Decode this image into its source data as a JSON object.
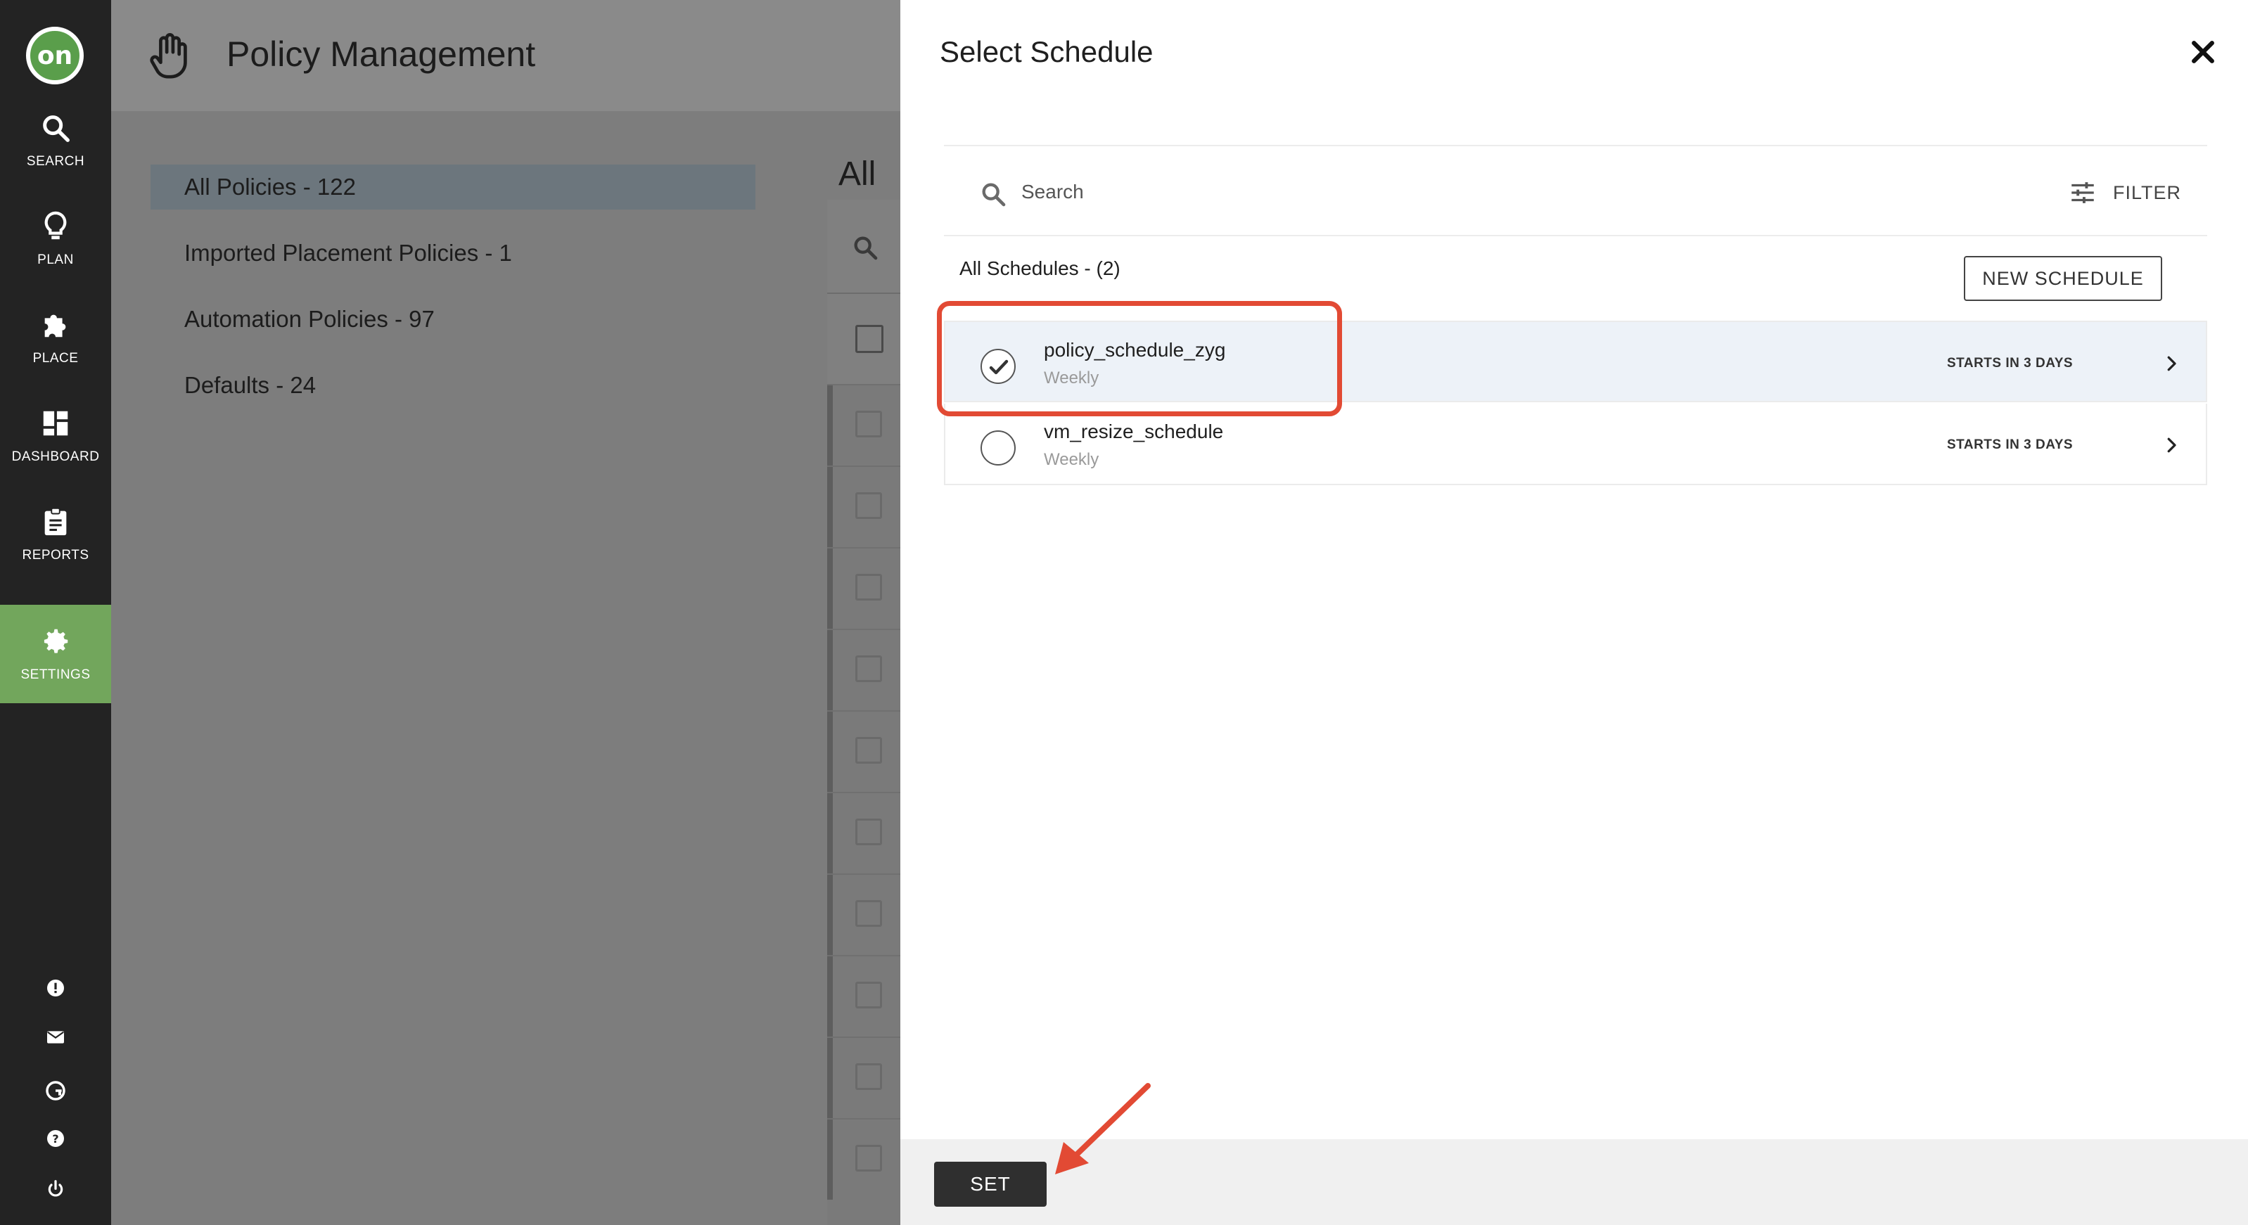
{
  "nav": {
    "logo_text": "on",
    "items": [
      {
        "label": "SEARCH",
        "icon": "search-icon"
      },
      {
        "label": "PLAN",
        "icon": "lightbulb-icon"
      },
      {
        "label": "PLACE",
        "icon": "puzzle-icon"
      },
      {
        "label": "DASHBOARD",
        "icon": "dashboard-icon"
      },
      {
        "label": "REPORTS",
        "icon": "clipboard-icon"
      },
      {
        "label": "SETTINGS",
        "icon": "gear-icon",
        "active": true
      }
    ],
    "utility_icons": [
      "alert-icon",
      "mail-icon",
      "g-logo-icon",
      "help-icon",
      "power-icon"
    ]
  },
  "page": {
    "title": "Policy Management",
    "categories": [
      {
        "label": "All Policies - 122",
        "active": true
      },
      {
        "label": "Imported Placement Policies - 1"
      },
      {
        "label": "Automation Policies - 97"
      },
      {
        "label": "Defaults - 24"
      }
    ],
    "list_title_peek": "All P"
  },
  "panel": {
    "title": "Select Schedule",
    "search_placeholder": "Search",
    "filter_label": "FILTER",
    "all_schedules_label": "All Schedules - (2)",
    "new_schedule_label": "NEW SCHEDULE",
    "schedules": [
      {
        "name": "policy_schedule_zyg",
        "frequency": "Weekly",
        "starts": "STARTS IN 3 DAYS",
        "selected": true
      },
      {
        "name": "vm_resize_schedule",
        "frequency": "Weekly",
        "starts": "STARTS IN 3 DAYS",
        "selected": false
      }
    ],
    "set_label": "SET"
  },
  "colors": {
    "nav_bg": "#232323",
    "nav_active": "#72a65c",
    "logo_green": "#5a9e4b",
    "overlay_gray": "#7d7d7d",
    "selected_row": "#edf2f8",
    "annotation_red": "#e24a34",
    "set_button": "#2f2f2f"
  }
}
